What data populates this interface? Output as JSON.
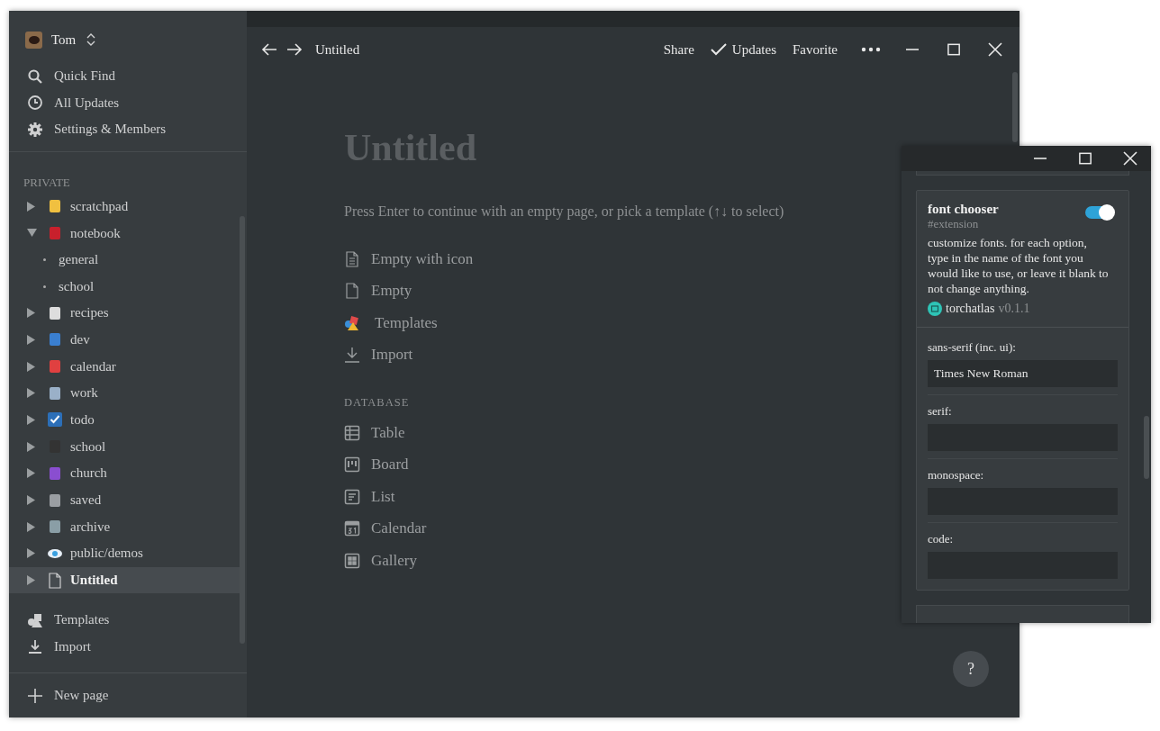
{
  "sidebar": {
    "workspace": "Tom",
    "menu": [
      "Quick Find",
      "All Updates",
      "Settings & Members"
    ],
    "section": "PRIVATE",
    "pages": [
      {
        "label": "scratchpad",
        "expanded": false,
        "selected": false
      },
      {
        "label": "notebook",
        "expanded": true,
        "selected": false,
        "children": [
          {
            "label": "general"
          },
          {
            "label": "school"
          }
        ]
      },
      {
        "label": "recipes",
        "expanded": false,
        "selected": false
      },
      {
        "label": "dev",
        "expanded": false,
        "selected": false
      },
      {
        "label": "calendar",
        "expanded": false,
        "selected": false
      },
      {
        "label": "work",
        "expanded": false,
        "selected": false
      },
      {
        "label": "todo",
        "expanded": false,
        "selected": false
      },
      {
        "label": "school",
        "expanded": false,
        "selected": false
      },
      {
        "label": "church",
        "expanded": false,
        "selected": false
      },
      {
        "label": "saved",
        "expanded": false,
        "selected": false
      },
      {
        "label": "archive",
        "expanded": false,
        "selected": false
      },
      {
        "label": "public/demos",
        "expanded": false,
        "selected": false
      },
      {
        "label": "Untitled",
        "expanded": false,
        "selected": true
      }
    ],
    "bottom": [
      "Templates",
      "Import"
    ],
    "new_page": "New page"
  },
  "topbar": {
    "breadcrumb": "Untitled",
    "actions": [
      "Share",
      "Updates",
      "Favorite"
    ]
  },
  "page": {
    "title": "Untitled",
    "hint": "Press Enter to continue with an empty page, or pick a template (↑↓ to select)",
    "options": [
      "Empty with icon",
      "Empty",
      "Templates",
      "Import"
    ],
    "database_heading": "DATABASE",
    "database": [
      "Table",
      "Board",
      "List",
      "Calendar",
      "Gallery"
    ],
    "help": "?"
  },
  "extension_window": {
    "name": "font chooser",
    "tag": "#extension",
    "on": true,
    "description": "customize fonts. for each option, type in the name of the font you would like to use, or leave it blank to not change anything.",
    "author": "torchatlas",
    "version": "v0.1.1",
    "fields": [
      {
        "label": "sans-serif (inc. ui):",
        "value": "Times New Roman"
      },
      {
        "label": "serif:"
      },
      {
        "label": "monospace:"
      },
      {
        "label": "code:"
      }
    ]
  }
}
